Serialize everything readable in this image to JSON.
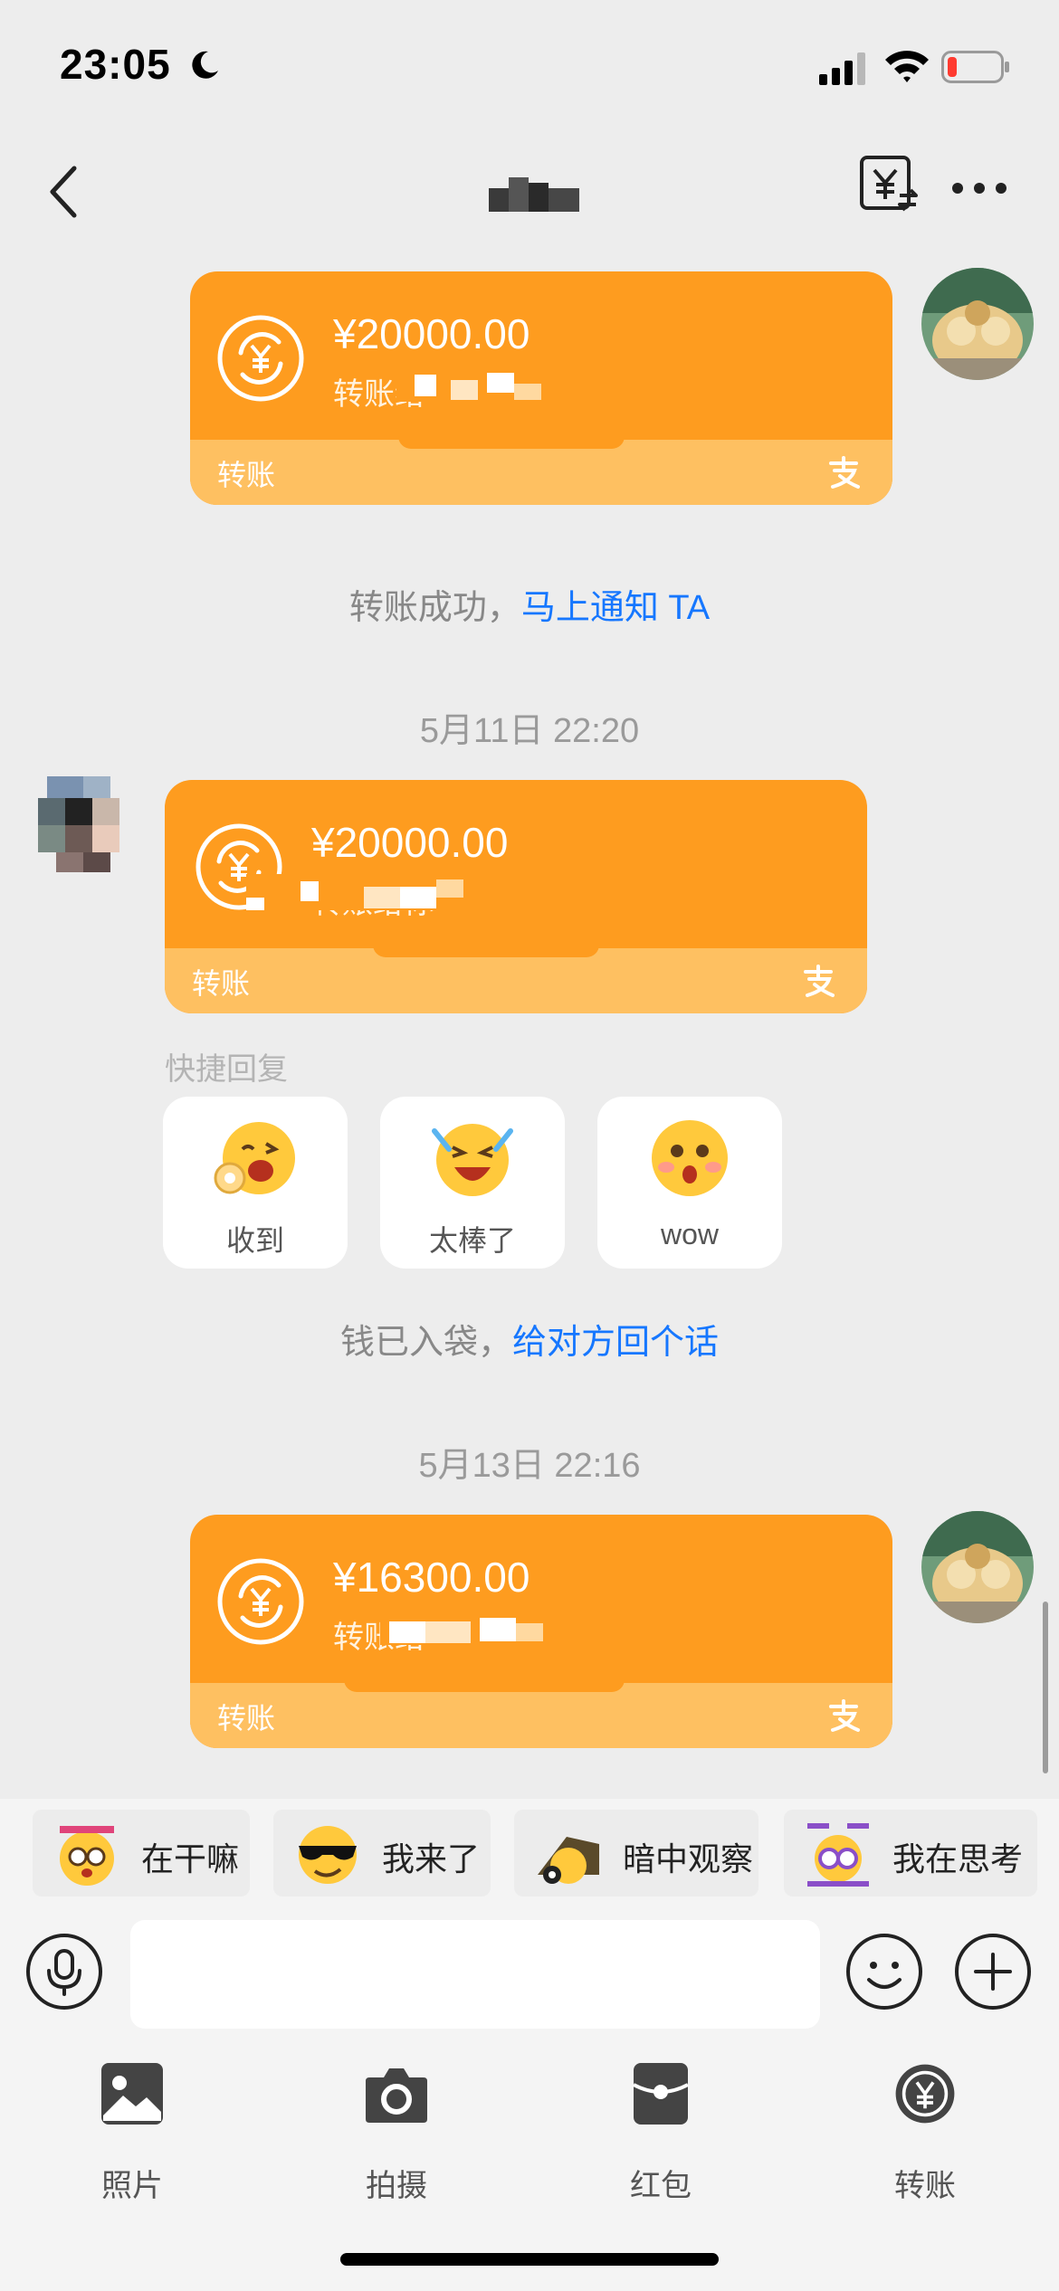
{
  "status_bar": {
    "time": "23:05"
  },
  "header": {
    "title": ""
  },
  "messages": [
    {
      "side": "right",
      "amount": "¥20000.00",
      "subtitle": "转账给",
      "footer": "转账"
    },
    {
      "side": "left",
      "amount": "¥20000.00",
      "subtitle": "转账给你",
      "footer": "转账"
    },
    {
      "side": "right",
      "amount": "¥16300.00",
      "subtitle": "转账给",
      "footer": "转账"
    }
  ],
  "system_notes": {
    "transfer_success": {
      "text": "转账成功，",
      "link": "马上通知 TA"
    },
    "money_received": {
      "text": "钱已入袋，",
      "link": "给对方回个话"
    }
  },
  "timestamps": [
    "5月11日 22:20",
    "5月13日 22:16"
  ],
  "quick_reply": {
    "title": "快捷回复",
    "items": [
      {
        "label": "收到",
        "icon": "ok-hand-emoji"
      },
      {
        "label": "太棒了",
        "icon": "tears-of-joy-emoji"
      },
      {
        "label": "wow",
        "icon": "surprised-emoji"
      }
    ]
  },
  "stickers": [
    {
      "label": "在干嘛",
      "icon": "what-doing-sticker"
    },
    {
      "label": "我来了",
      "icon": "sunglasses-sticker"
    },
    {
      "label": "暗中观察",
      "icon": "peek-sticker"
    },
    {
      "label": "我在思考",
      "icon": "thinking-sticker"
    }
  ],
  "input": {
    "placeholder": ""
  },
  "tools": [
    {
      "label": "照片",
      "icon": "photo-icon"
    },
    {
      "label": "拍摄",
      "icon": "camera-icon"
    },
    {
      "label": "红包",
      "icon": "red-packet-icon"
    },
    {
      "label": "转账",
      "icon": "transfer-icon"
    }
  ],
  "colors": {
    "card_orange": "#fe9c1f",
    "card_footer": "#fec061",
    "link_blue": "#1677ff",
    "background": "#ededed"
  }
}
